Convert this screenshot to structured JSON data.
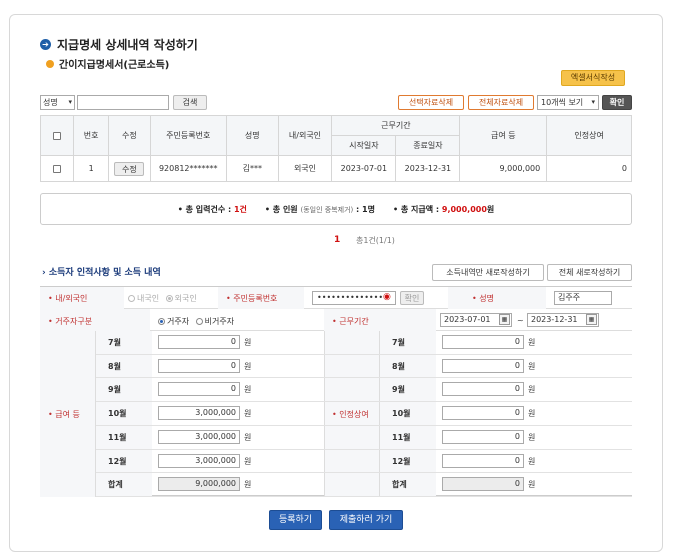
{
  "page_title": "지급명세 상세내역 작성하기",
  "subtitle": "간이지급명세서(근로소득)",
  "excel_button": "엑셀서식작성",
  "toolbar": {
    "search_field": "성명",
    "search_button": "검색",
    "delete_selected": "선택자료삭제",
    "delete_all": "전체자료삭제",
    "view_count": "10개씩 보기",
    "confirm": "확인"
  },
  "table": {
    "headers": {
      "no": "번호",
      "edit": "수정",
      "rrn": "주민등록번호",
      "name": "성명",
      "nationality": "내/외국인",
      "work_period": "근무기간",
      "start": "시작일자",
      "end": "종료일자",
      "salary": "급여 등",
      "bonus": "인정상여"
    },
    "rows": [
      {
        "no": "1",
        "edit": "수정",
        "rrn": "920812*******",
        "name": "김***",
        "nationality": "외국인",
        "start": "2023-07-01",
        "end": "2023-12-31",
        "salary": "9,000,000",
        "bonus": "0"
      }
    ]
  },
  "summary": {
    "count_label": "• 총 입력건수 :",
    "count_value": "1건",
    "people_label": "• 총 인원",
    "people_note": "(동일인 중복제거)",
    "people_value": ": 1명",
    "amount_label": "• 총 지급액 :",
    "amount_value": "9,000,000",
    "amount_unit": "원"
  },
  "pager": {
    "current": "1",
    "info": "총1건(1/1)"
  },
  "section": {
    "title": "› 소득자 인적사항 및 소득 내역",
    "new_income_button": "소득내역만 새로작성하기",
    "new_all_button": "전체 새로작성하기"
  },
  "form": {
    "nationality_label": "• 내/외국인",
    "domestic": "내국인",
    "foreign": "외국인",
    "rrn_label": "• 주민등록번호",
    "rrn_value": "••••••••••••••",
    "confirm_small": "확인",
    "name_label": "• 성명",
    "name_value": "김주주",
    "residency_label": "• 거주자구분",
    "resident": "거주자",
    "nonresident": "비거주자",
    "period_label": "• 근무기간",
    "period_start": "2023-07-01",
    "period_tilde": "~",
    "period_end": "2023-12-31",
    "salary_label": "• 급여 등",
    "bonus_label": "• 인정상여",
    "unit": "원",
    "months": [
      "7월",
      "8월",
      "9월",
      "10월",
      "11월",
      "12월",
      "합계"
    ],
    "salary_values": [
      "0",
      "0",
      "0",
      "3,000,000",
      "3,000,000",
      "3,000,000",
      "9,000,000"
    ],
    "bonus_values": [
      "0",
      "0",
      "0",
      "0",
      "0",
      "0",
      "0"
    ]
  },
  "buttons": {
    "register": "등록하기",
    "submit": "제출하러 가기"
  },
  "colors": {
    "accent_blue": "#2a62b5",
    "accent_orange": "#f0a020",
    "red": "#d01010"
  }
}
